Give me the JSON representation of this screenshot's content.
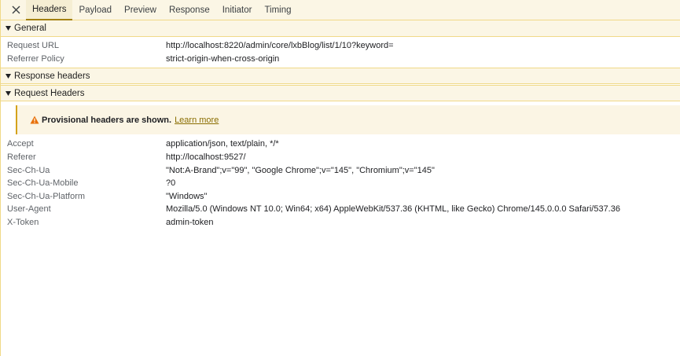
{
  "tabs": [
    {
      "label": "Headers",
      "active": true
    },
    {
      "label": "Payload",
      "active": false
    },
    {
      "label": "Preview",
      "active": false
    },
    {
      "label": "Response",
      "active": false
    },
    {
      "label": "Initiator",
      "active": false
    },
    {
      "label": "Timing",
      "active": false
    }
  ],
  "general": {
    "title": "General",
    "rows": [
      {
        "name": "Request URL",
        "value": "http://localhost:8220/admin/core/lxbBlog/list/1/10?keyword="
      },
      {
        "name": "Referrer Policy",
        "value": "strict-origin-when-cross-origin"
      }
    ]
  },
  "response_headers": {
    "title": "Response headers"
  },
  "request_headers": {
    "title": "Request Headers",
    "warning": {
      "text": "Provisional headers are shown.",
      "link": "Learn more"
    },
    "rows": [
      {
        "name": "Accept",
        "value": "application/json, text/plain, */*"
      },
      {
        "name": "Referer",
        "value": "http://localhost:9527/"
      },
      {
        "name": "Sec-Ch-Ua",
        "value": "\"Not:A-Brand\";v=\"99\", \"Google Chrome\";v=\"145\", \"Chromium\";v=\"145\""
      },
      {
        "name": "Sec-Ch-Ua-Mobile",
        "value": "?0"
      },
      {
        "name": "Sec-Ch-Ua-Platform",
        "value": "\"Windows\""
      },
      {
        "name": "User-Agent",
        "value": "Mozilla/5.0 (Windows NT 10.0; Win64; x64) AppleWebKit/537.36 (KHTML, like Gecko) Chrome/145.0.0.0 Safari/537.36"
      },
      {
        "name": "X-Token",
        "value": "admin-token"
      }
    ]
  },
  "icons": {
    "close": "close-icon",
    "expanded": "triangle-down-icon",
    "warning": "warning-triangle-icon"
  },
  "colors": {
    "accent": "#a48111",
    "header_bg": "#fbf6e5",
    "border": "#f0d988",
    "warning": "#e8710a"
  }
}
